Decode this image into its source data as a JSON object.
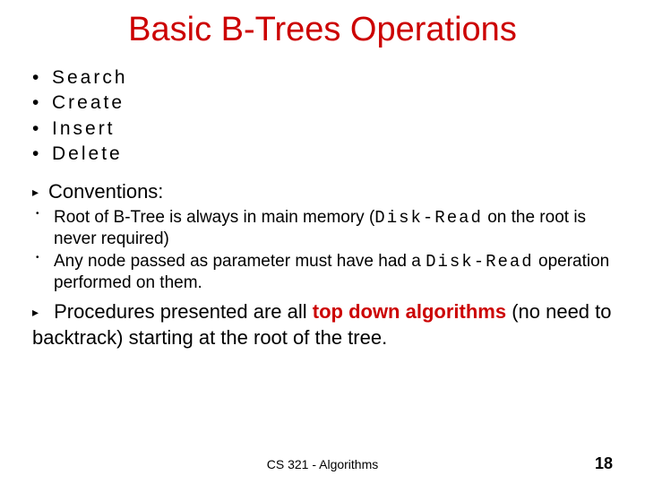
{
  "title": "Basic B-Trees Operations",
  "operations": [
    "Search",
    "Create",
    "Insert",
    "Delete"
  ],
  "conventions": {
    "heading": "Conventions:",
    "items": [
      {
        "pre": "Root of B-Tree is always in main memory (",
        "code": "Disk-Read",
        "post": " on the root is never required)"
      },
      {
        "pre": "Any node passed as parameter must have had a ",
        "code": "Disk-Read",
        "post": " operation performed on them."
      }
    ]
  },
  "procedures": {
    "pre": "Procedures presented are all ",
    "emph": "top down algorithms",
    "post": " (no need to backtrack) starting at the root of the tree."
  },
  "footer": {
    "course": "CS 321 - Algorithms",
    "page": "18"
  }
}
